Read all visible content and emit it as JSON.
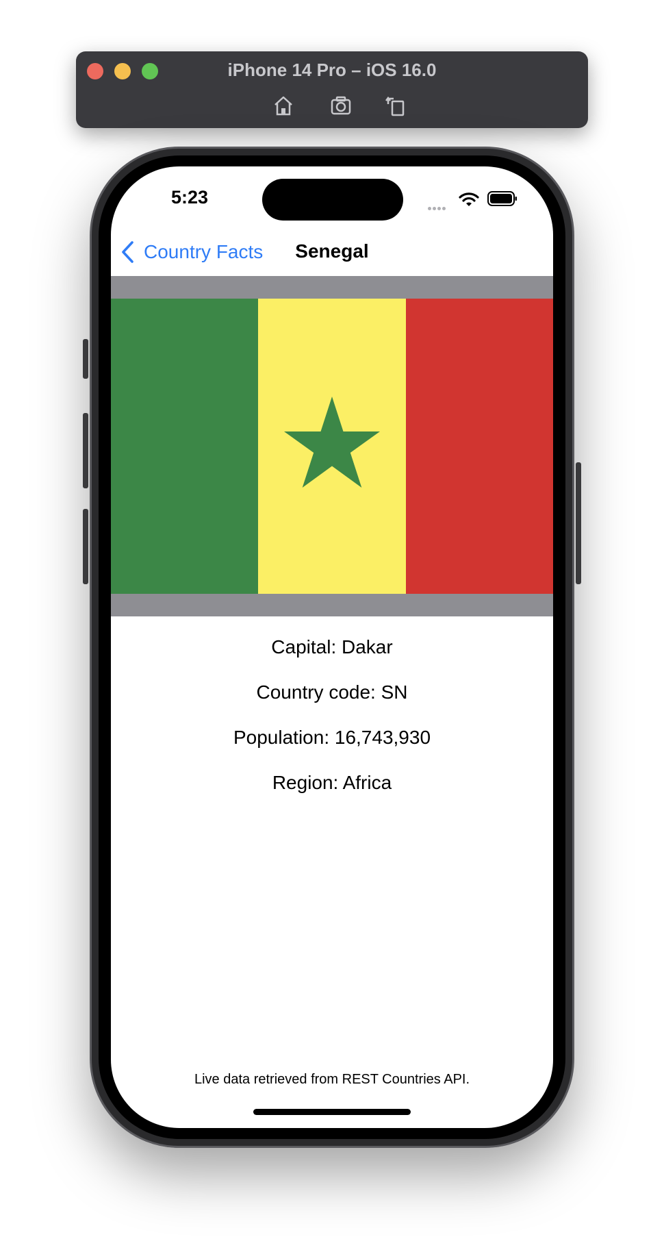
{
  "simulator": {
    "title": "iPhone 14 Pro – iOS 16.0",
    "toolbar_icons": [
      "home-icon",
      "screenshot-icon",
      "rotate-icon"
    ]
  },
  "status_bar": {
    "time": "5:23"
  },
  "nav": {
    "back_label": "Country Facts",
    "title": "Senegal"
  },
  "flag": {
    "colors": [
      "#3c8747",
      "#fbef65",
      "#d13530"
    ],
    "star_color": "#3c8747",
    "background": "#8e8e93"
  },
  "facts": {
    "capital": "Capital: Dakar",
    "country_code": "Country code: SN",
    "population": "Population: 16,743,930",
    "region": "Region: Africa"
  },
  "footer": {
    "note": "Live data retrieved from REST Countries API."
  },
  "accent": "#2f7cf6"
}
